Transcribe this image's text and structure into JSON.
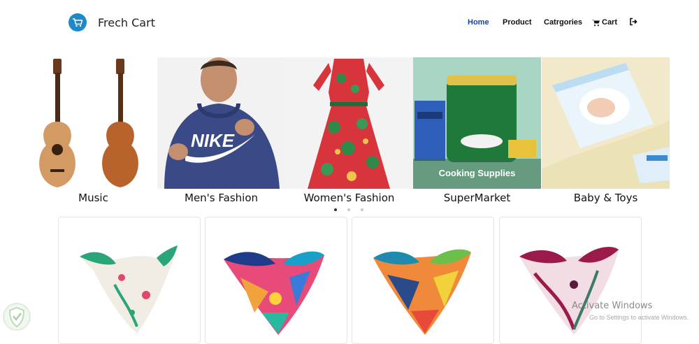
{
  "brand": {
    "name": "Frech Cart",
    "logo_icon": "cart-icon",
    "accent": "#1e88c9"
  },
  "nav": {
    "items": [
      {
        "label": "Home",
        "active": true
      },
      {
        "label": "Product",
        "active": false
      },
      {
        "label": "Catrgories",
        "active": false
      },
      {
        "label": "Cart",
        "icon": "cart-icon",
        "active": false
      }
    ],
    "logout_icon": "sign-out-icon",
    "active_color": "#1a3fa8"
  },
  "carousel": {
    "slides": [
      {
        "label": "Music",
        "image": "guitars"
      },
      {
        "label": "Men's Fashion",
        "image": "hoodie-model"
      },
      {
        "label": "Women's Fashion",
        "image": "floral-dress"
      },
      {
        "label": "SuperMarket",
        "image": "grocery-products",
        "overlay_text": "Cooking Supplies"
      },
      {
        "label": "Baby & Toys",
        "image": "diapers"
      }
    ],
    "dot_count": 3,
    "active_dot": 0
  },
  "products": [
    {
      "image": "scarf-white-green"
    },
    {
      "image": "scarf-colorful"
    },
    {
      "image": "scarf-geometric"
    },
    {
      "image": "scarf-magenta"
    }
  ],
  "watermark": {
    "title": "Activate Windows",
    "subtitle": "Go to Settings to activate Windows."
  }
}
